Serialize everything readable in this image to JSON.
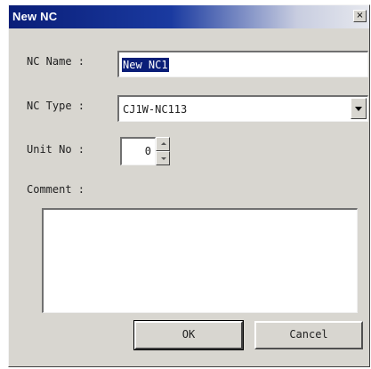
{
  "window": {
    "title": "New NC",
    "close_label": "×"
  },
  "form": {
    "nc_name_label": "NC Name :",
    "nc_name_value": "New NC1",
    "nc_type_label": "NC Type :",
    "nc_type_value": "CJ1W-NC113",
    "unit_no_label": "Unit No :",
    "unit_no_value": "0",
    "comment_label": "Comment :",
    "comment_value": ""
  },
  "buttons": {
    "ok_label": "OK",
    "cancel_label": "Cancel"
  },
  "colors": {
    "titlebar_start": "#0a1e78",
    "dialog_bg": "#d8d6d0",
    "selection_bg": "#0a1e78"
  },
  "icons": {
    "close": "close-icon",
    "dropdown": "chevron-down-icon",
    "spin_up": "arrow-up-icon",
    "spin_down": "arrow-down-icon"
  }
}
